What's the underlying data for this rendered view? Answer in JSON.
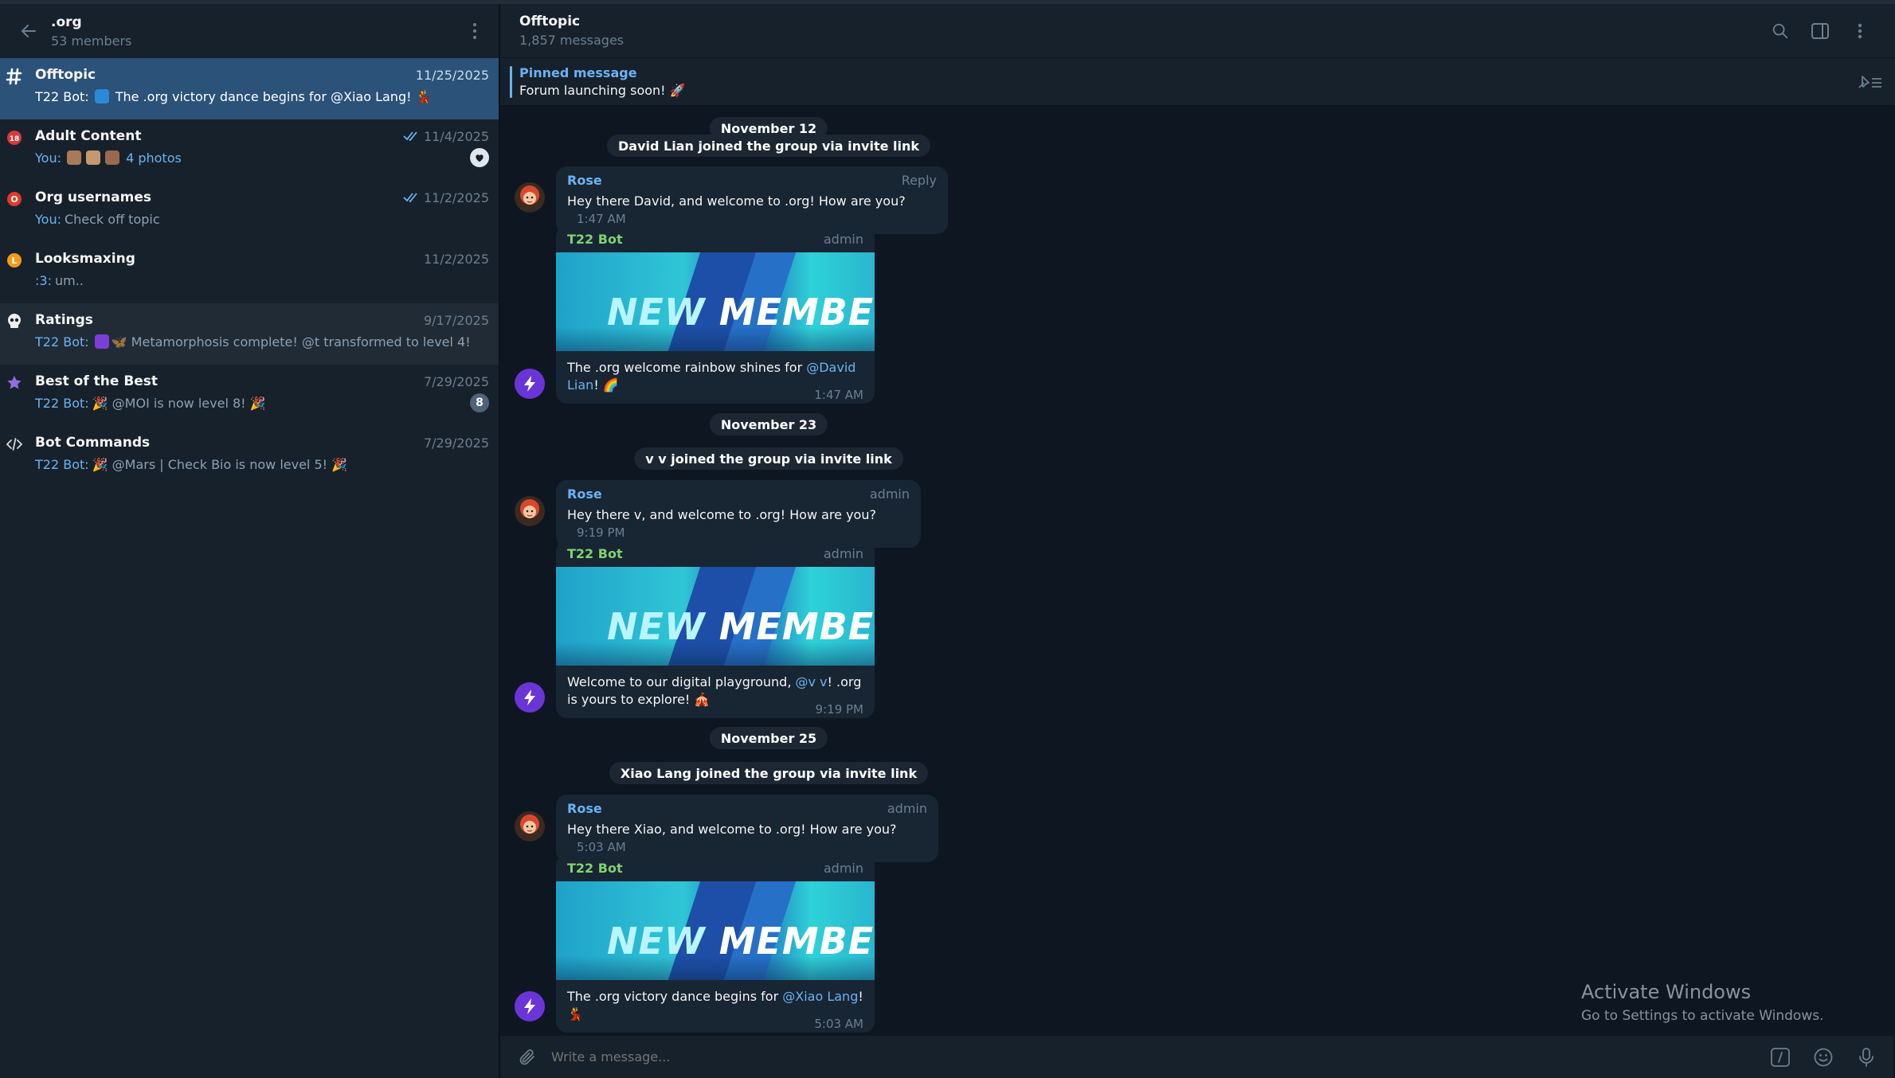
{
  "sidebar": {
    "group_name": ".org",
    "members": "53 members",
    "topics": [
      {
        "name": "Offtopic",
        "date": "11/25/2025",
        "sender": "T22 Bot:",
        "preview": "The .org victory dance begins for @Xiao Lang!",
        "icon": "hash-icon"
      },
      {
        "name": "Adult Content",
        "date": "11/4/2025",
        "sender": "You:",
        "preview": "4 photos",
        "icon": "adult-icon"
      },
      {
        "name": "Org usernames",
        "date": "11/2/2025",
        "sender": "You:",
        "preview": "Check off topic",
        "icon": "o-icon"
      },
      {
        "name": "Looksmaxing",
        "date": "11/2/2025",
        "sender": ":3:",
        "preview": "um..",
        "icon": "l-icon"
      },
      {
        "name": "Ratings",
        "date": "9/17/2025",
        "sender": "T22 Bot:",
        "preview": "Metamorphosis complete! @t transformed to level 4!",
        "icon": "skull-icon"
      },
      {
        "name": "Best of the Best",
        "date": "7/29/2025",
        "sender": "T22 Bot:",
        "preview": "@MOI is now level 8!",
        "badge": "8",
        "icon": "star-icon"
      },
      {
        "name": "Bot Commands",
        "date": "7/29/2025",
        "sender": "T22 Bot:",
        "preview": "@Mars | Check Bio is now level 5!",
        "icon": "code-icon"
      }
    ]
  },
  "chat": {
    "title": "Offtopic",
    "subtitle": "1,857 messages",
    "pinned_label": "Pinned message",
    "pinned_text": "Forum launching soon! 🚀",
    "composer_placeholder": "Write a message..."
  },
  "messages": {
    "date1": "November 12",
    "svc1": "David Lian joined the group via invite link",
    "m1": {
      "name": "Rose",
      "role": "Reply",
      "text": "Hey there David, and welcome to .org! How are you?",
      "time": "1:47 AM"
    },
    "b1": {
      "name": "T22 Bot",
      "role": "admin",
      "pre": "The .org welcome rainbow shines for ",
      "mention": "@David Lian",
      "post": "! 🌈",
      "time": "1:47 AM"
    },
    "date2": "November 23",
    "svc2": "v v joined the group via invite link",
    "m2": {
      "name": "Rose",
      "role": "admin",
      "text": "Hey there v, and welcome to .org! How are you?",
      "time": "9:19 PM"
    },
    "b2": {
      "name": "T22 Bot",
      "role": "admin",
      "pre": "Welcome to our digital playground, ",
      "mention": "@v v",
      "post": "! .org is yours to explore! 🎪",
      "time": "9:19 PM"
    },
    "date3": "November 25",
    "svc3": "Xiao Lang joined the group via invite link",
    "m3": {
      "name": "Rose",
      "role": "admin",
      "text": "Hey there Xiao, and welcome to .org! How are you?",
      "time": "5:03 AM"
    },
    "b3": {
      "name": "T22 Bot",
      "role": "admin",
      "pre": "The .org victory dance begins for ",
      "mention": "@Xiao Lang",
      "post": "! 💃",
      "time": "5:03 AM"
    },
    "banner_word1": "NEW",
    "banner_word2": "MEMBER"
  },
  "watermark": {
    "line1": "Activate Windows",
    "line2": "Go to Settings to activate Windows."
  },
  "colors": {
    "accent": "#6ab3f3",
    "active_topic": "#2b5278",
    "bot_name": "#7fd36e"
  }
}
